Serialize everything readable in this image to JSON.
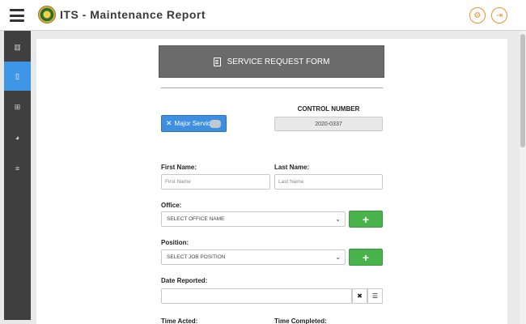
{
  "header": {
    "title": "ITS - Maintenance Report",
    "menu_icon": "hamburger-icon",
    "logo": "seal-logo",
    "settings_icon": "gear-icon",
    "logout_icon": "logout-icon",
    "accent_color": "#f0912a"
  },
  "sidebar": {
    "items": [
      {
        "name": "dashboard",
        "icon": "chart-icon",
        "glyph": "▥"
      },
      {
        "name": "report",
        "icon": "file-icon",
        "glyph": "▯",
        "active": true
      },
      {
        "name": "table",
        "icon": "table-icon",
        "glyph": "⊞"
      },
      {
        "name": "stats",
        "icon": "pie-chart-icon",
        "glyph": "◕"
      },
      {
        "name": "database",
        "icon": "database-icon",
        "glyph": "≡"
      }
    ],
    "active_color": "#3f95e6"
  },
  "form": {
    "title": "SERVICE REQUEST FORM",
    "major_service_label": "Major Service",
    "control_number_label": "CONTROL NUMBER",
    "control_number_value": "2020-0337",
    "first_name_label": "First Name:",
    "first_name_placeholder": "First Name",
    "last_name_label": "Last Name:",
    "last_name_placeholder": "Last Name",
    "office_label": "Office:",
    "office_value": "SELECT OFFICE NAME",
    "position_label": "Position:",
    "position_value": "SELECT JOB POSITION",
    "date_reported_label": "Date Reported:",
    "time_acted_label": "Time Acted:",
    "time_completed_label": "Time Completed:",
    "plus": "+",
    "clear_glyph": "✖",
    "calendar_glyph": "☰"
  }
}
